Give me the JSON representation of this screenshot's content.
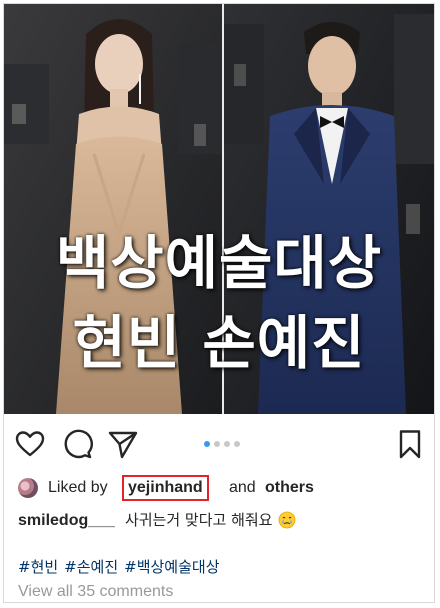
{
  "post": {
    "caption_line1": "백상예술대상",
    "caption_line2": "현빈 손예진",
    "liked_by_prefix": "Liked by",
    "liked_by_user": "yejinhand",
    "liked_by_and": "and",
    "liked_by_others": "others",
    "comment_user": "smiledog___",
    "comment_text": "사귀는거 맞다고 해줘요",
    "hashtags": [
      "#현빈",
      "#손예진",
      "#백상예술대상"
    ],
    "view_all_comments": "View all 35 comments",
    "carousel_count": 4,
    "carousel_active_index": 0
  },
  "icons": {
    "like": "heart-icon",
    "comment": "comment-bubble-icon",
    "share": "paper-plane-icon",
    "save": "bookmark-icon",
    "emoji": "crying-face-emoji"
  },
  "colors": {
    "highlight_box": "#e2232a",
    "hashtag": "#003569",
    "carousel_active": "#3897f0",
    "muted_text": "#999999"
  }
}
